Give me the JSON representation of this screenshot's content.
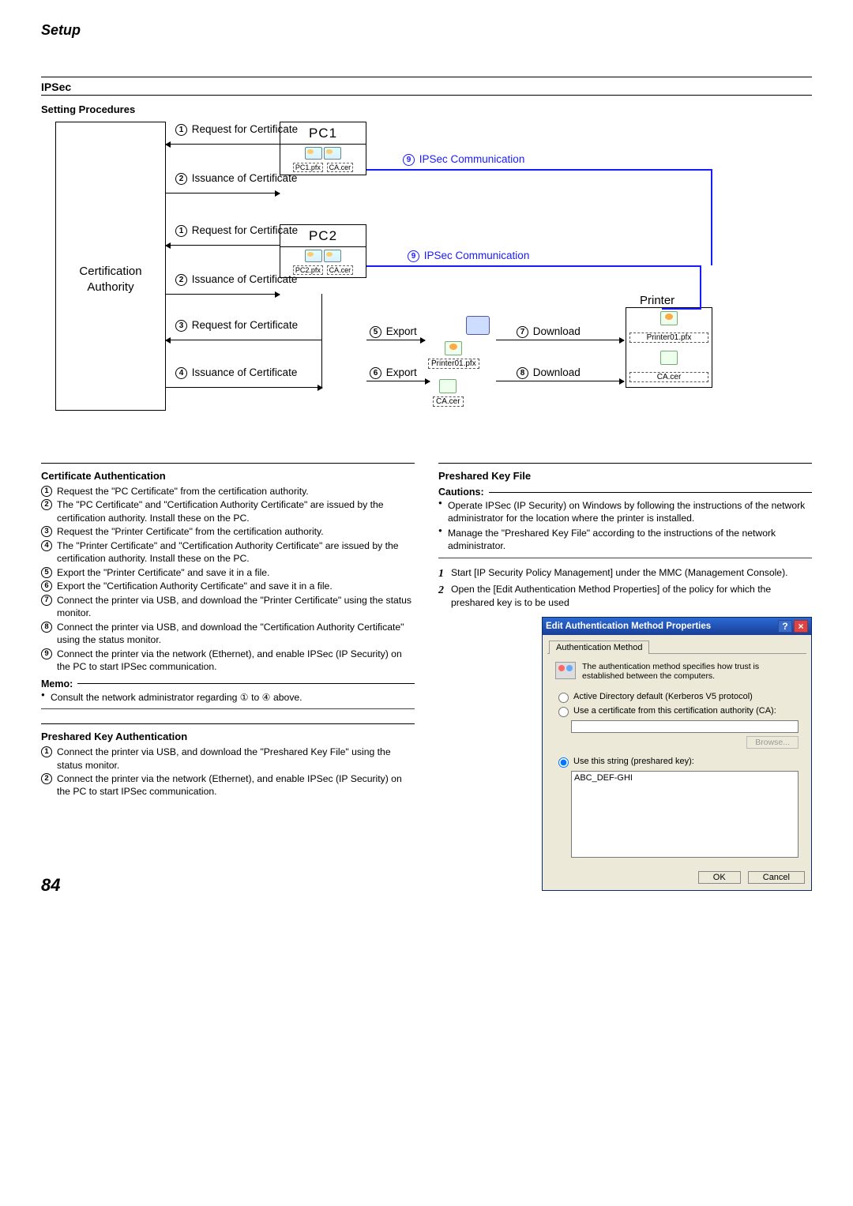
{
  "page": {
    "title": "Setup",
    "number": "84"
  },
  "headings": {
    "ipsec": "IPSec",
    "setting_procedures": "Setting Procedures",
    "cert_auth": "Certificate Authentication",
    "memo": "Memo:",
    "psk_auth": "Preshared Key Authentication",
    "psk_file": "Preshared Key File",
    "cautions": "Cautions:"
  },
  "diagram": {
    "ca": "Certification Authority",
    "pc1": "PC1",
    "pc2": "PC2",
    "pc1_f1": "PC1.pfx",
    "pc1_f2": "CA.cer",
    "pc2_f1": "PC2.pfx",
    "pc2_f2": "CA.cer",
    "printer": "Printer",
    "printer_pfx": "Printer01.pfx",
    "printer_pfx2": "Printer01.pfx",
    "ca_cer": "CA.cer",
    "ca_cer2": "CA.cer",
    "s1": "Request for Certificate",
    "s2": "Issuance of Certificate",
    "s3": "Request for Certificate",
    "s4": "Issuance of Certificate",
    "s5": "Request for Certificate",
    "s6": "Issuance of Certificate",
    "s_exp5": "Export",
    "s_exp6": "Export",
    "s_dl7": "Download",
    "s_dl8": "Download",
    "s_comm": "IPSec Communication",
    "n1": "1",
    "n2": "2",
    "n3": "3",
    "n4": "4",
    "n5": "5",
    "n6": "6",
    "n7": "7",
    "n8": "8",
    "n9": "9"
  },
  "cert_steps": [
    "Request the \"PC Certificate\" from the certification authority.",
    "The \"PC Certificate\" and \"Certification Authority Certificate\" are issued by the certification authority. Install these on the PC.",
    "Request the \"Printer Certificate\" from the certification authority.",
    "The \"Printer Certificate\" and \"Certification Authority Certificate\" are issued by the certification authority. Install these on the PC.",
    "Export the \"Printer Certificate\" and save it in a file.",
    "Export the \"Certification Authority Certificate\" and save it in a file.",
    "Connect the printer via USB, and download the \"Printer Certificate\" using the status monitor.",
    "Connect the printer via USB, and download the \"Certification Authority Certificate\" using the status monitor.",
    "Connect the printer via the network (Ethernet), and enable IPSec (IP Security) on the PC to start IPSec communication."
  ],
  "memo_text": "Consult the network administrator regarding ① to ④ above.",
  "psk_steps": [
    "Connect the printer via USB, and download the \"Preshared Key File\" using the status monitor.",
    "Connect the printer via the network (Ethernet), and enable IPSec (IP Security) on the PC to start IPSec communication."
  ],
  "cautions": [
    "Operate IPSec (IP Security) on Windows by following the instructions of the network administrator for the location where the printer is installed.",
    "Manage the \"Preshared Key File\" according to the instructions of the network administrator."
  ],
  "num_steps": [
    "Start [IP Security Policy Management] under the MMC (Management Console).",
    "Open the [Edit Authentication Method Properties] of the policy for which the preshared key is to be used"
  ],
  "dialog": {
    "title": "Edit Authentication Method Properties",
    "tab": "Authentication Method",
    "desc": "The authentication method specifies how trust is established between the computers.",
    "opt1": "Active Directory default (Kerberos V5 protocol)",
    "opt2": "Use a certificate from this certification authority (CA):",
    "browse": "Browse...",
    "opt3": "Use this string (preshared key):",
    "value": "ABC_DEF-GHI",
    "ok": "OK",
    "cancel": "Cancel"
  }
}
